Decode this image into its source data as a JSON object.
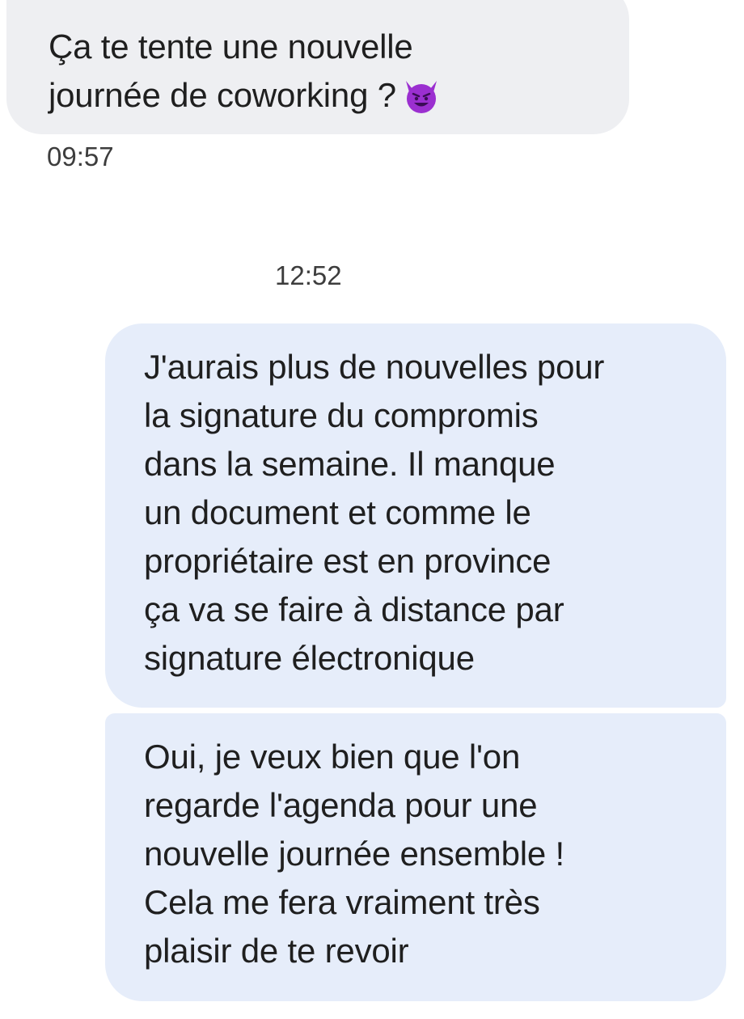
{
  "conversation": {
    "messages": [
      {
        "direction": "incoming",
        "lines": [
          "Ça te tente une nouvelle",
          "journée de coworking ?"
        ],
        "emoji": "smiling-devil-emoji",
        "time": "09:57"
      },
      {
        "direction": "outgoing",
        "time": "12:52",
        "lines": [
          "J'aurais plus de nouvelles pour",
          "la signature du compromis",
          "dans la semaine. Il manque",
          "un document et comme le",
          "propriétaire est en province",
          "ça va se faire à distance par",
          "signature électronique"
        ]
      },
      {
        "direction": "outgoing",
        "lines": [
          "Oui, je veux bien que l'on",
          "regarde l'agenda pour une",
          "nouvelle journée ensemble !",
          "Cela me fera vraiment très",
          "plaisir de te revoir"
        ]
      }
    ]
  },
  "colors": {
    "incoming_bubble": "#eeeff2",
    "outgoing_bubble": "#e6edfa",
    "emoji_purple": "#9b2fd0"
  }
}
